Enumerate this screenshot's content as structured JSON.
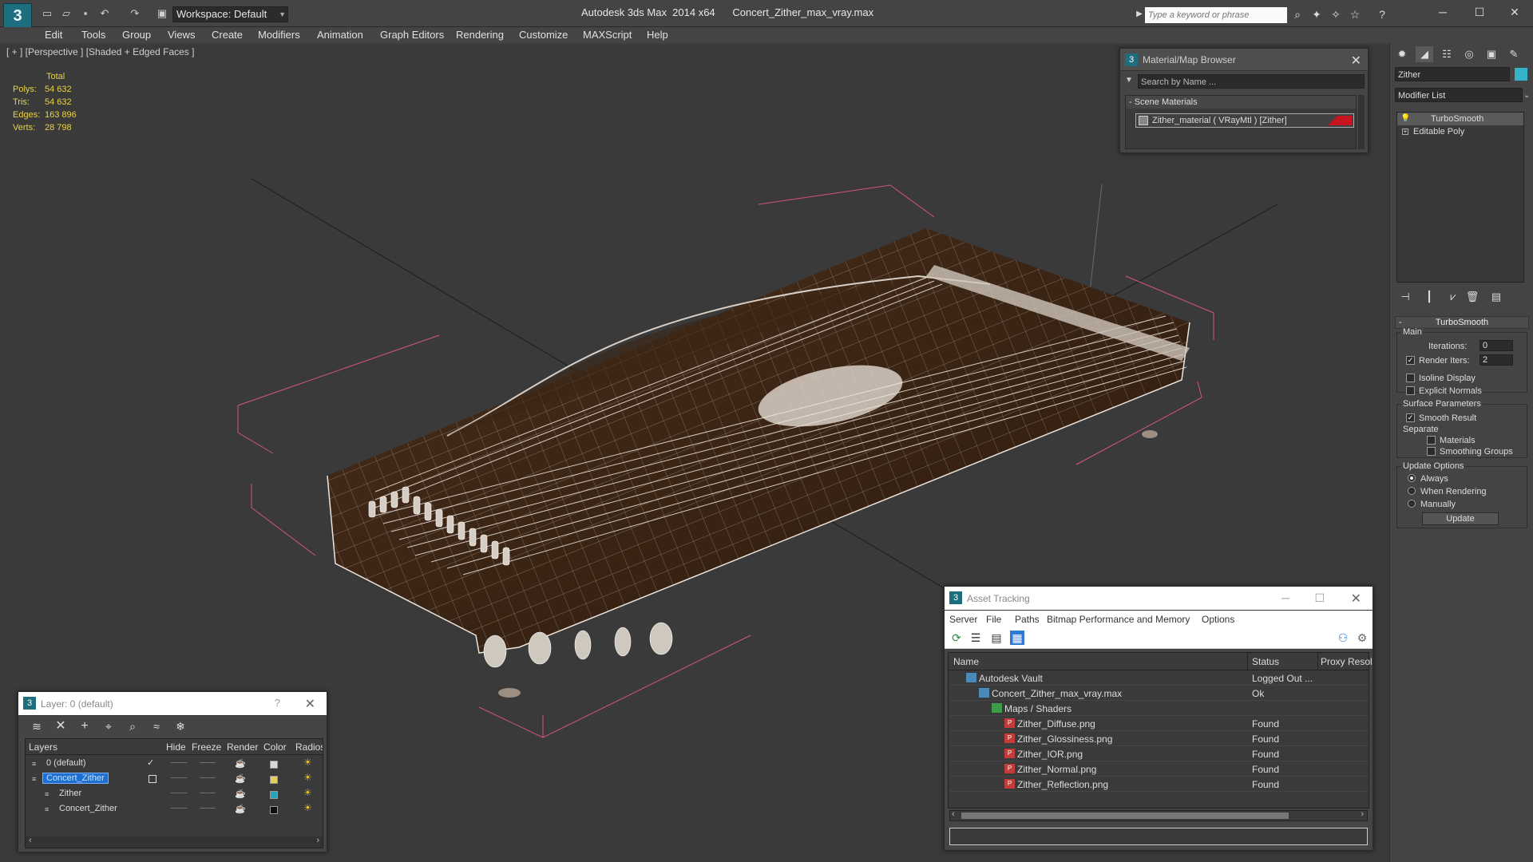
{
  "titlebar": {
    "workspace": "Workspace: Default",
    "title": "Autodesk 3ds Max  2014 x64      Concert_Zither_max_vray.max",
    "search_placeholder": "Type a keyword or phrase"
  },
  "menu": [
    "Edit",
    "Tools",
    "Group",
    "Views",
    "Create",
    "Modifiers",
    "Animation",
    "Graph Editors",
    "Rendering",
    "Customize",
    "MAXScript",
    "Help"
  ],
  "viewport": {
    "label": "[ + ] [Perspective ] [Shaded + Edged Faces ]",
    "stats": {
      "header": "Total",
      "rows": [
        {
          "label": "Polys:",
          "value": "54 632"
        },
        {
          "label": "Tris:",
          "value": "54 632"
        },
        {
          "label": "Edges:",
          "value": "163 896"
        },
        {
          "label": "Verts:",
          "value": "28 798"
        }
      ]
    }
  },
  "material_browser": {
    "title": "Material/Map Browser",
    "search_placeholder": "Search by Name ...",
    "section": "- Scene Materials",
    "item": "Zither_material  ( VRayMtl ) [Zither]",
    "swatch_color": "#c8141e"
  },
  "command_panel": {
    "object_name": "Zither",
    "object_color": "#35b3c8",
    "modifier_list": "Modifier List",
    "stack": [
      "TurboSmooth",
      "Editable Poly"
    ],
    "rollout": "TurboSmooth",
    "main": {
      "title": "Main",
      "iterations_label": "Iterations:",
      "iterations_value": "0",
      "render_iters_label": "Render Iters:",
      "render_iters_value": "2",
      "isoline": "Isoline Display",
      "explicit": "Explicit Normals"
    },
    "surface": {
      "title": "Surface Parameters",
      "smooth": "Smooth Result",
      "separate": "Separate",
      "materials": "Materials",
      "smoothing_groups": "Smoothing Groups"
    },
    "update": {
      "title": "Update Options",
      "always": "Always",
      "when_rendering": "When Rendering",
      "manually": "Manually",
      "button": "Update"
    }
  },
  "asset_tracking": {
    "title": "Asset Tracking",
    "menu": [
      "Server",
      "File",
      "Paths",
      "Bitmap Performance and Memory",
      "Options"
    ],
    "columns": [
      "Name",
      "Status",
      "Proxy Resol"
    ],
    "rows": [
      {
        "name": "Autodesk Vault",
        "status": "Logged Out ...",
        "indent": 0,
        "icon": "vault-icon"
      },
      {
        "name": "Concert_Zither_max_vray.max",
        "status": "Ok",
        "indent": 1,
        "icon": "max-file-icon"
      },
      {
        "name": "Maps / Shaders",
        "status": "",
        "indent": 2,
        "icon": "maps-folder-icon"
      },
      {
        "name": "Zither_Diffuse.png",
        "status": "Found",
        "indent": 3,
        "icon": "png-icon"
      },
      {
        "name": "Zither_Glossiness.png",
        "status": "Found",
        "indent": 3,
        "icon": "png-icon"
      },
      {
        "name": "Zither_IOR.png",
        "status": "Found",
        "indent": 3,
        "icon": "png-icon"
      },
      {
        "name": "Zither_Normal.png",
        "status": "Found",
        "indent": 3,
        "icon": "png-icon"
      },
      {
        "name": "Zither_Reflection.png",
        "status": "Found",
        "indent": 3,
        "icon": "png-icon"
      }
    ]
  },
  "layer_manager": {
    "title": "Layer: 0 (default)",
    "columns": [
      "Layers",
      "Hide",
      "Freeze",
      "Render",
      "Color",
      "Radiosit"
    ],
    "rows": [
      {
        "name": "0 (default)",
        "indent": 1,
        "selected": false,
        "color": "#d8d8d8"
      },
      {
        "name": "Concert_Zither",
        "indent": 1,
        "selected": true,
        "color": "#e0d060"
      },
      {
        "name": "Zither",
        "indent": 2,
        "selected": false,
        "color": "#2aa3bd"
      },
      {
        "name": "Concert_Zither",
        "indent": 2,
        "selected": false,
        "color": "#101010"
      }
    ]
  }
}
